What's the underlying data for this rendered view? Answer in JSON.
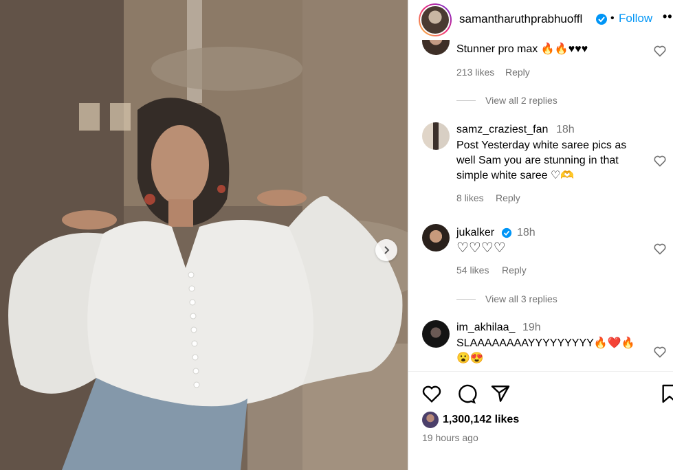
{
  "header": {
    "username": "samantharuthprabhuoffl",
    "separator": "•",
    "follow_label": "Follow",
    "more_label": "•••"
  },
  "comments": [
    {
      "text": "Stunner pro max 🔥🔥♥♥♥",
      "likes": "213 likes",
      "reply": "Reply",
      "view_replies": "View all 2 replies"
    },
    {
      "user": "samz_craziest_fan",
      "time": "18h",
      "text": "Post Yesterday white saree pics as well Sam you are stunning in that simple white saree ♡🫶",
      "likes": "8 likes",
      "reply": "Reply"
    },
    {
      "user": "jukalker",
      "verified": true,
      "time": "18h",
      "text": "♡♡♡♡",
      "likes": "54 likes",
      "reply": "Reply",
      "view_replies": "View all 3 replies"
    },
    {
      "user": "im_akhilaa_",
      "time": "19h",
      "text": "SLAAAAAAAAYYYYYYYYY🔥❤️🔥",
      "text2": "😮😍"
    }
  ],
  "post": {
    "likes": "1,300,142 likes",
    "posted": "19 hours ago"
  },
  "colors": {
    "accent": "#0095f6",
    "muted": "#737373",
    "divider": "#dbdbdb"
  },
  "icons": [
    "heart-icon",
    "comment-icon",
    "share-icon",
    "bookmark-icon",
    "verified-icon",
    "chevron-right-icon"
  ]
}
